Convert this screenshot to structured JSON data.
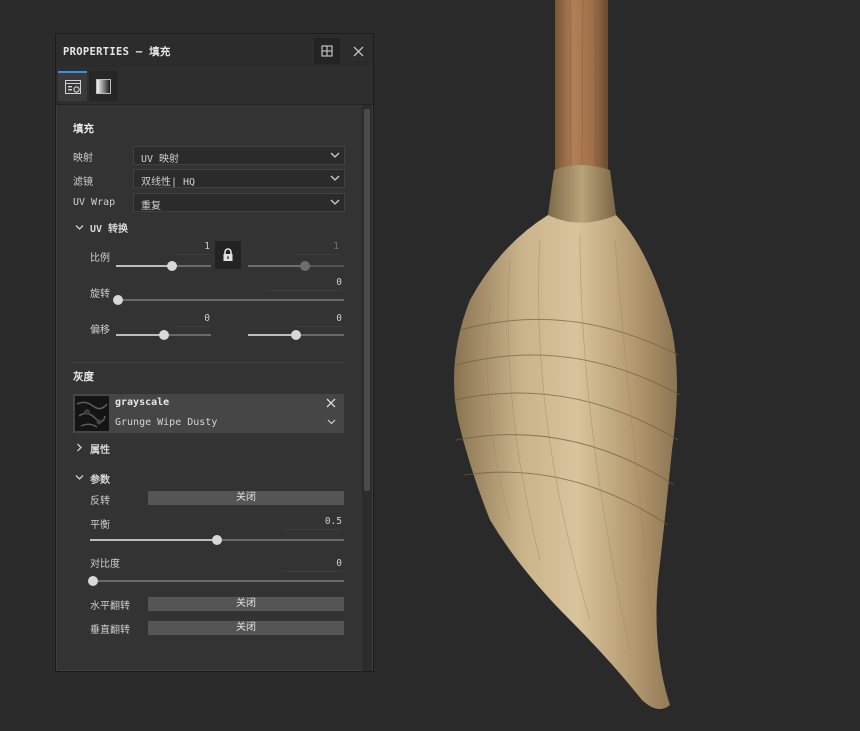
{
  "panel": {
    "title": "PROPERTIES – 填充",
    "icons": {
      "dock": "dock-panel-icon",
      "close": "close-icon",
      "tab1": "fill-properties-icon",
      "tab2": "gradient-icon"
    }
  },
  "fill": {
    "header": "填充",
    "mapping": {
      "label": "映射",
      "value": "UV 映射"
    },
    "filter": {
      "label": "滤镜",
      "value": "双线性| HQ"
    },
    "uv_wrap": {
      "label": "UV Wrap",
      "value": "重复"
    }
  },
  "uv_transform": {
    "header": "UV 转换",
    "scale": {
      "label": "比例",
      "value_a": "1",
      "value_b": "1",
      "locked": true,
      "slider_a": 0.59,
      "slider_b": 0.59
    },
    "rotation": {
      "label": "旋转",
      "value": "0",
      "slider": 0.0
    },
    "offset": {
      "label": "偏移",
      "value_a": "0",
      "value_b": "0",
      "slider_a": 0.5,
      "slider_b": 0.5
    }
  },
  "grayscale": {
    "header": "灰度",
    "resource": {
      "name": "grayscale",
      "subtitle": "Grunge Wipe Dusty"
    },
    "attributes": {
      "header": "属性"
    },
    "params": {
      "header": "参数",
      "invert": {
        "label": "反转",
        "value": "关闭"
      },
      "balance": {
        "label": "平衡",
        "value": "0.5",
        "slider": 0.5
      },
      "contrast": {
        "label": "对比度",
        "value": "0",
        "slider": 0.0
      },
      "flip_h": {
        "label": "水平翻转",
        "value": "关闭"
      },
      "flip_v": {
        "label": "垂直翻转",
        "value": "关闭"
      }
    }
  },
  "colors": {
    "accent": "#3b8ee5",
    "panel": "#333333",
    "viewport": "#2a2a2a"
  }
}
